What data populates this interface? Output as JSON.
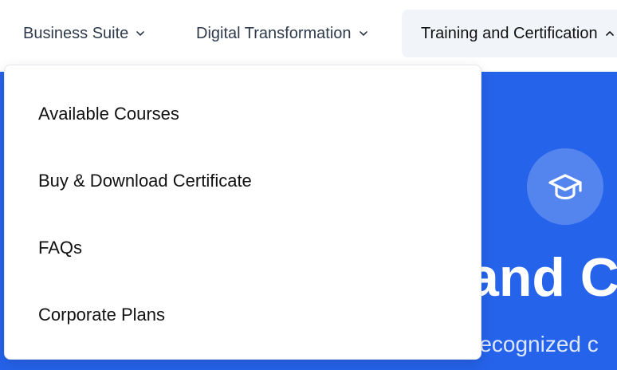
{
  "nav": {
    "items": [
      {
        "label": "Business Suite",
        "icon": "chevron-down-icon"
      },
      {
        "label": "Digital Transformation",
        "icon": "chevron-down-icon"
      },
      {
        "label": "Training and Certification",
        "icon": "chevron-up-icon",
        "active": true
      }
    ]
  },
  "dropdown": {
    "items": [
      "Available Courses",
      "Buy & Download Certificate",
      "FAQs",
      "Corporate Plans"
    ]
  },
  "hero": {
    "icon": "graduation-cap-icon",
    "title_fragment": "and C",
    "subtitle_fragment": "recognized c",
    "background": "#2563eb"
  },
  "colors": {
    "accent": "#2563eb",
    "nav_text": "#2f3b4c",
    "active_bg": "#f1f4f8"
  }
}
